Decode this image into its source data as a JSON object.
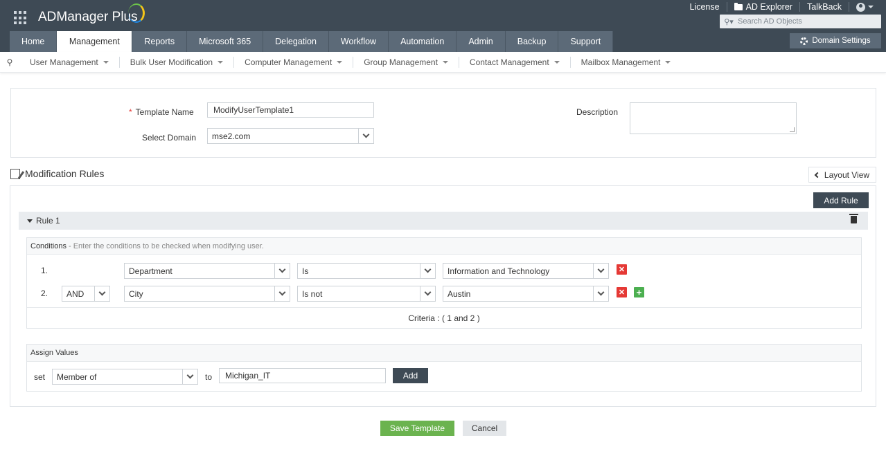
{
  "app": {
    "title": "ADManager Plus"
  },
  "top_links": {
    "license": "License",
    "ad_explorer": "AD Explorer",
    "talkback": "TalkBack"
  },
  "search": {
    "placeholder": "Search AD Objects"
  },
  "tabs": [
    "Home",
    "Management",
    "Reports",
    "Microsoft 365",
    "Delegation",
    "Workflow",
    "Automation",
    "Admin",
    "Backup",
    "Support"
  ],
  "active_tab": "Management",
  "domain_settings": "Domain Settings",
  "submenu": [
    "User Management",
    "Bulk User Modification",
    "Computer Management",
    "Group Management",
    "Contact Management",
    "Mailbox Management"
  ],
  "form": {
    "template_name_label": "Template Name",
    "template_name_value": "ModifyUserTemplate1",
    "select_domain_label": "Select Domain",
    "domain_value": "mse2.com",
    "description_label": "Description",
    "description_value": ""
  },
  "modification_rules": {
    "title": "Modification Rules",
    "layout_view": "Layout View",
    "add_rule": "Add Rule",
    "rule_title": "Rule 1",
    "conditions_label": "Conditions",
    "conditions_hint": "- Enter the conditions to be checked when modifying user.",
    "conditions": [
      {
        "num": "1.",
        "operator": "",
        "attribute": "Department",
        "comparison": "Is",
        "value": "Information and Technology"
      },
      {
        "num": "2.",
        "operator": "AND",
        "attribute": "City",
        "comparison": "Is not",
        "value": "Austin"
      }
    ],
    "criteria": "Criteria : ( 1 and 2 )",
    "assign_label": "Assign Values",
    "set_label": "set",
    "set_attribute": "Member of",
    "to_label": "to",
    "to_value": "Michigan_IT",
    "add_button": "Add"
  },
  "footer": {
    "save": "Save Template",
    "cancel": "Cancel"
  },
  "colors": {
    "header": "#3e4a55",
    "tab": "#5c6a78",
    "save": "#6bb34f",
    "delete": "#e53935",
    "add": "#4caf50"
  }
}
